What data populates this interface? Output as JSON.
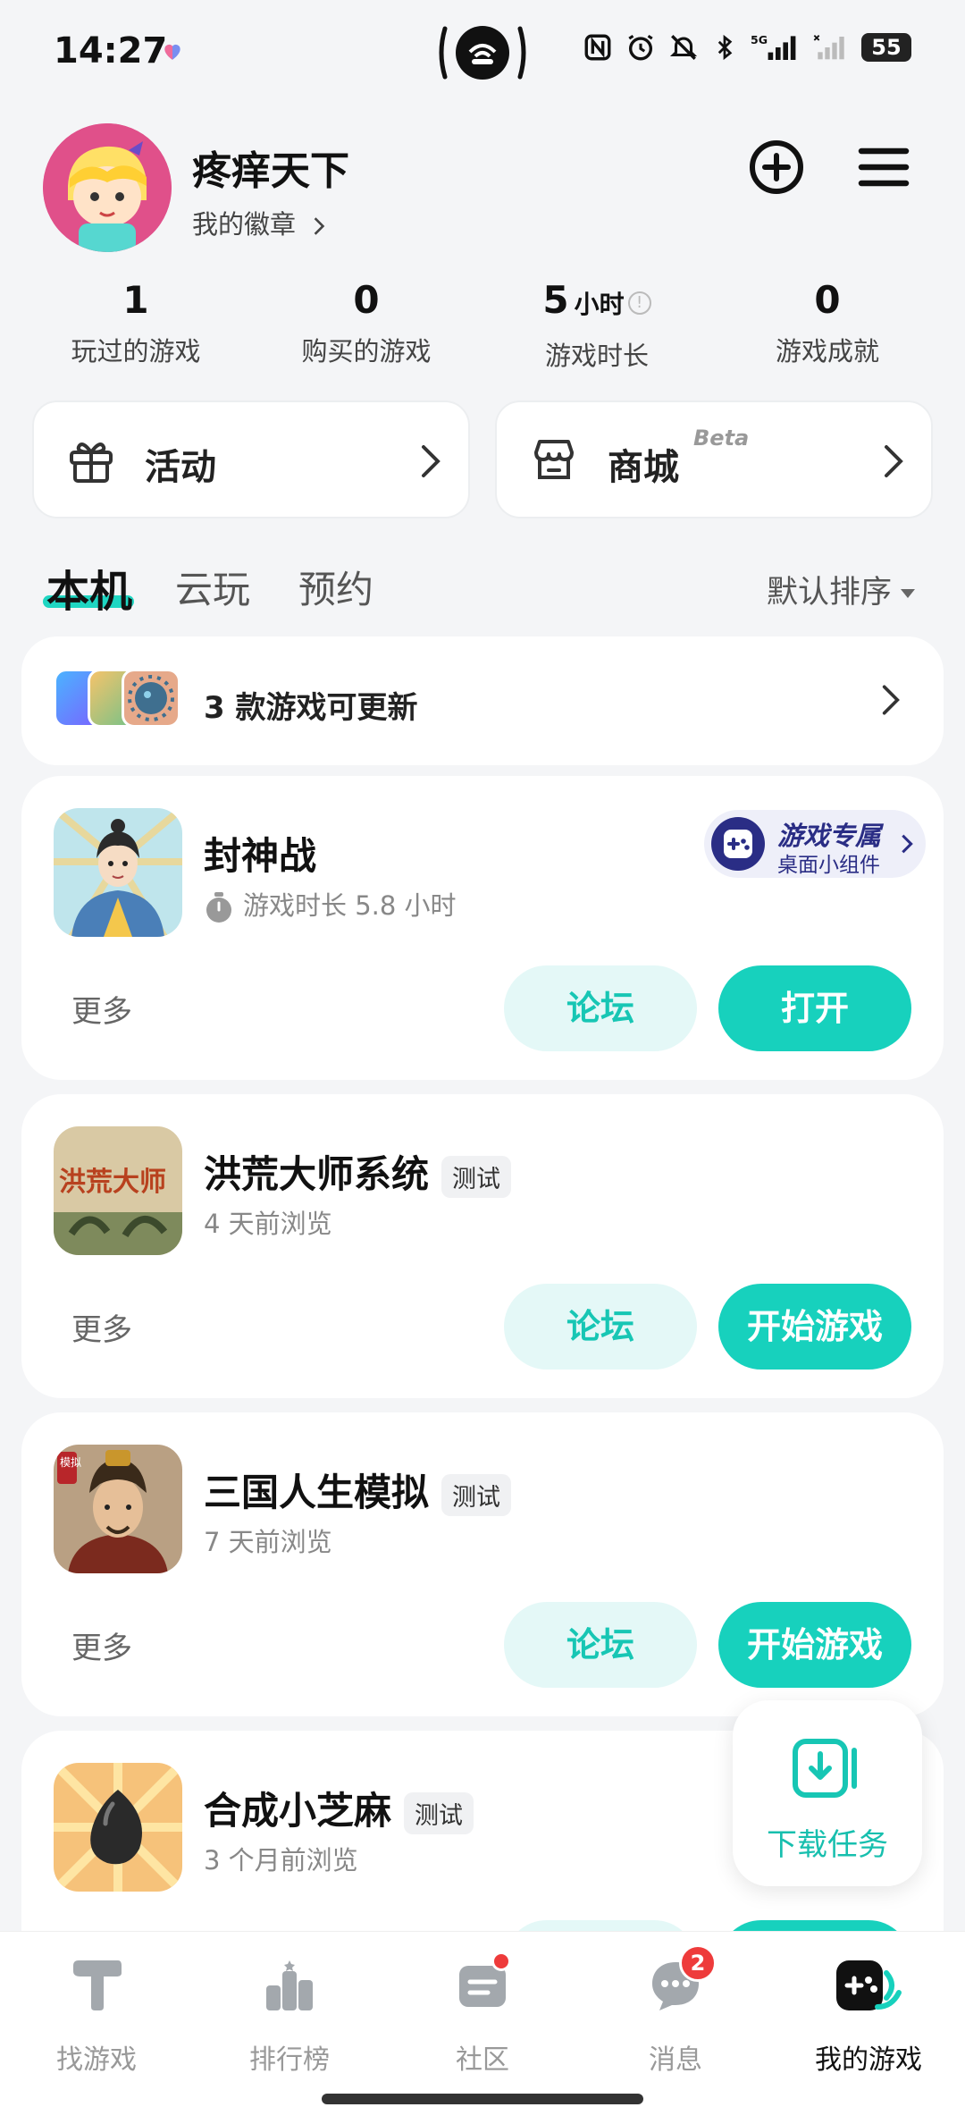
{
  "status_bar": {
    "time": "14:27",
    "battery": "55"
  },
  "profile": {
    "username": "疼痒天下",
    "badge_link": "我的徽章"
  },
  "stats": [
    {
      "value": "1",
      "unit": "",
      "label": "玩过的游戏"
    },
    {
      "value": "0",
      "unit": "",
      "label": "购买的游戏"
    },
    {
      "value": "5",
      "unit": "小时",
      "label": "游戏时长"
    },
    {
      "value": "0",
      "unit": "",
      "label": "游戏成就"
    }
  ],
  "quick_cards": {
    "activity": "活动",
    "shop": "商城",
    "shop_tag": "Beta"
  },
  "tabs": [
    {
      "label": "本机"
    },
    {
      "label": "云玩"
    },
    {
      "label": "预约"
    }
  ],
  "sort": {
    "label": "默认排序"
  },
  "update_banner": {
    "text": "3 款游戏可更新"
  },
  "games": [
    {
      "name": "封神战",
      "tag": "",
      "sub": "游戏时长 5.8 小时",
      "more": "更多",
      "forum": "论坛",
      "primary": "打开"
    },
    {
      "name": "洪荒大师系统",
      "tag": "测试",
      "sub": "4 天前浏览",
      "more": "更多",
      "forum": "论坛",
      "primary": "开始游戏"
    },
    {
      "name": "三国人生模拟",
      "tag": "测试",
      "sub": "7 天前浏览",
      "more": "更多",
      "forum": "论坛",
      "primary": "开始游戏"
    },
    {
      "name": "合成小芝麻",
      "tag": "测试",
      "sub": "3 个月前浏览"
    }
  ],
  "widget_pill": {
    "title": "游戏专属",
    "subtitle": "桌面小组件"
  },
  "game_icon_text": {
    "honghuang": "洪荒大师",
    "sanguo_stamp": "模拟"
  },
  "download_float": {
    "label": "下载任务"
  },
  "bottom_nav": [
    {
      "label": "找游戏"
    },
    {
      "label": "排行榜"
    },
    {
      "label": "社区"
    },
    {
      "label": "消息",
      "badge": "2"
    },
    {
      "label": "我的游戏"
    }
  ],
  "colors": {
    "accent": "#17d1bd",
    "accent_light": "#e4f8f7",
    "badge_red": "#ee3b3b",
    "widget_blue": "#2a2d85"
  }
}
